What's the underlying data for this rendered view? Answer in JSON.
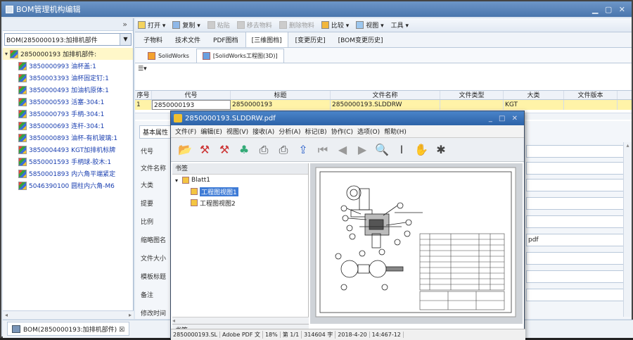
{
  "app": {
    "title": "BOM管理机构编辑"
  },
  "sidebar": {
    "combo": "BOM(2850000193:加排机部件",
    "root": "2850000193 加排机部件:",
    "items": [
      "3850000993 油杯盖:1",
      "3850003393 油杯固定钉:1",
      "3850000493 加油机原体:1",
      "3850000593 活塞-304:1",
      "3850000793 手柄-304:1",
      "3850000693 连杆-304:1",
      "3850000893 油杯-有机玻璃:1",
      "3850004493 KGT加排机标牌",
      "5850001593 手柄球-胶木:1",
      "5850001893 内六角平端紧定",
      "5046390100 圆柱内六角-M6"
    ]
  },
  "toolbar": {
    "open": "打开 ▾",
    "copy": "复制 ▾",
    "paste": "粘贴",
    "remove": "移去物料",
    "delete": "删除物料",
    "compare": "比较 ▾",
    "view": "视图 ▾",
    "tools": "工具 ▾"
  },
  "tabs": [
    "子物料",
    "技术文件",
    "PDF图档",
    "[三维图档]",
    "[变更历史]",
    "[BOM变更历史]"
  ],
  "subtabs": [
    "SolidWorks",
    "[SolidWorks工程图(3D)]"
  ],
  "grid": {
    "columns": [
      "序号",
      "代号",
      "标题",
      "文件名称",
      "文件类型",
      "大类",
      "文件版本"
    ],
    "row": [
      "1",
      "2850000193",
      "2850000193",
      "2850000193.SLDDRW",
      "",
      "KGT",
      ""
    ]
  },
  "props": {
    "tab": "基本属性",
    "labels": [
      "代号",
      "文件名称",
      "大类",
      "提要",
      "比例",
      "缩略图名",
      "文件大小",
      "模板标题",
      "备注",
      "修改时间"
    ],
    "pdf_field": "pdf"
  },
  "bottom_tab": "BOM(2850000193:加排机部件) ☒",
  "pdf": {
    "title": "2850000193.SLDDRW.pdf",
    "menu": [
      "文件(F)",
      "编辑(E)",
      "视图(V)",
      "接收(A)",
      "分析(A)",
      "标记(B)",
      "协作(C)",
      "选项(O)",
      "帮助(H)"
    ],
    "bookmarks_header": "书签",
    "bookmarks": {
      "root": "Blatt1",
      "items": [
        "工程图视图1",
        "工程图视图2"
      ]
    },
    "footer_tab": "书签",
    "status": [
      "2850000193.SL",
      "Adobe PDF 文",
      "18%",
      "第 1/1",
      "314604 字",
      "2018-4-20",
      "14:467-12"
    ]
  },
  "colors": {
    "titlebar": "#5a85bb",
    "selection": "#fff3a8",
    "accent": "#3e7bd6"
  }
}
